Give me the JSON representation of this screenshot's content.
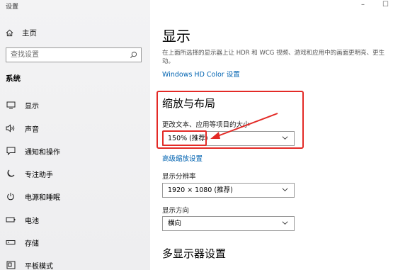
{
  "window": {
    "title": "设置",
    "minimize_glyph": "–",
    "maximize_glyph": "☐"
  },
  "sidebar": {
    "home_label": "主页",
    "search_placeholder": "查找设置",
    "section": "系统",
    "items": [
      {
        "label": "显示",
        "icon": "monitor-icon"
      },
      {
        "label": "声音",
        "icon": "speaker-icon"
      },
      {
        "label": "通知和操作",
        "icon": "message-icon"
      },
      {
        "label": "专注助手",
        "icon": "moon-icon"
      },
      {
        "label": "电源和睡眠",
        "icon": "power-icon"
      },
      {
        "label": "电池",
        "icon": "battery-icon"
      },
      {
        "label": "存储",
        "icon": "storage-icon"
      },
      {
        "label": "平板模式",
        "icon": "tablet-icon"
      }
    ]
  },
  "main": {
    "title": "显示",
    "description": "在上面所选择的显示器上让 HDR 和 WCG 视频、游戏和应用中的画面更明亮、更生动。",
    "hd_color_link": "Windows HD Color 设置",
    "scale_section_title": "缩放与布局",
    "scale_label": "更改文本、应用等项目的大小",
    "scale_value": "150% (推荐)",
    "advanced_scaling_link": "高级缩放设置",
    "resolution_label": "显示分辨率",
    "resolution_value": "1920 × 1080 (推荐)",
    "orientation_label": "显示方向",
    "orientation_value": "横向",
    "multi_display_title": "多显示器设置"
  },
  "colors": {
    "accent_link": "#0063b1",
    "annotation_red": "#e32a26"
  }
}
